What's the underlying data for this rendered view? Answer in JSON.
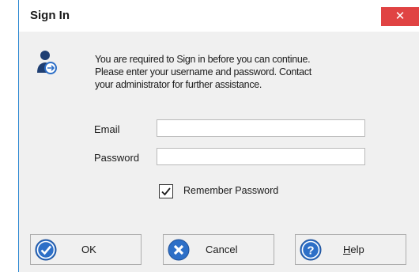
{
  "dialog": {
    "title": "Sign In",
    "close_glyph": "✕"
  },
  "message": {
    "line1": "You are required to Sign in before you can continue.",
    "line2": "Please enter your username and password. Contact",
    "line3": "your administrator for further assistance."
  },
  "form": {
    "email_label": "Email",
    "email_value": "",
    "password_label": "Password",
    "password_value": "",
    "remember_label": "Remember Password",
    "remember_checked": true
  },
  "buttons": {
    "ok_label": "OK",
    "cancel_label": "Cancel",
    "help_label_first": "H",
    "help_label_rest": "elp"
  },
  "icons": {
    "user": "user-icon",
    "ok": "checkmark-circle-icon",
    "cancel": "x-circle-icon",
    "help": "question-circle-icon"
  },
  "colors": {
    "accent": "#2b87d1",
    "close": "#e04343",
    "icon_blue": "#2d6fc7"
  }
}
